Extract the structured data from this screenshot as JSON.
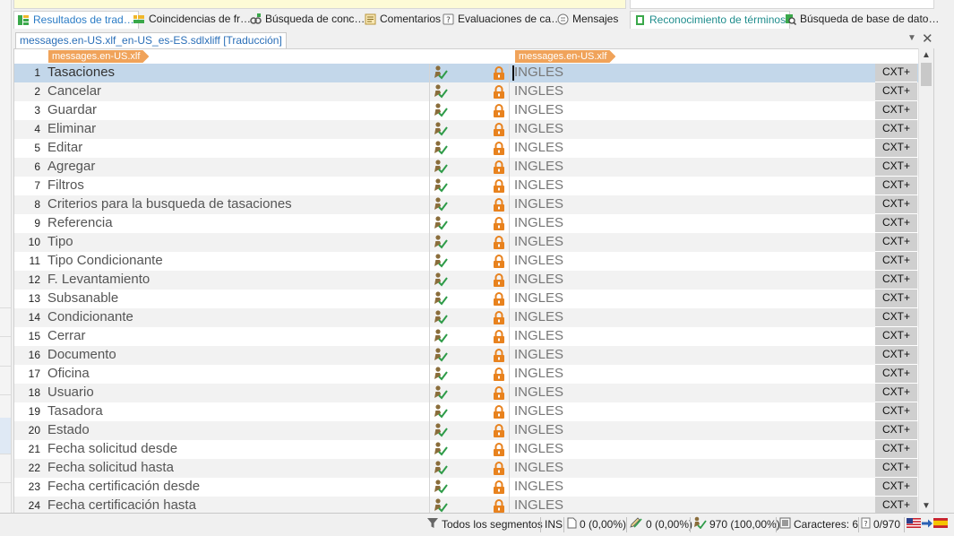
{
  "tabs_left": [
    {
      "label": "Resultados de trad…",
      "icon": "translation-results-icon",
      "active": true
    },
    {
      "label": "Coincidencias de fr…",
      "icon": "fragment-matches-icon"
    },
    {
      "label": "Búsqueda de conc…",
      "icon": "concordance-search-icon"
    },
    {
      "label": "Comentarios",
      "icon": "comments-icon"
    },
    {
      "label": "Evaluaciones de ca…",
      "icon": "quality-evaluation-icon"
    },
    {
      "label": "Mensajes",
      "icon": "messages-icon"
    }
  ],
  "tabs_right": [
    {
      "label": "Reconocimiento de términos",
      "icon": "term-recognition-icon",
      "active": true
    },
    {
      "label": "Búsqueda de base de dato…",
      "icon": "termbase-search-icon"
    }
  ],
  "document": {
    "tab_label": "messages.en-US.xlf_en-US_es-ES.sdlxliff [Traducción]",
    "source_file_tag": "messages.en-US.xlf",
    "target_file_tag": "messages.en-US.xlf"
  },
  "segments": [
    {
      "num": "1",
      "source": "Tasaciones",
      "target": "INGLES",
      "context": "CXT+"
    },
    {
      "num": "2",
      "source": "Cancelar",
      "target": "INGLES",
      "context": "CXT+"
    },
    {
      "num": "3",
      "source": "Guardar",
      "target": "INGLES",
      "context": "CXT+"
    },
    {
      "num": "4",
      "source": "Eliminar",
      "target": "INGLES",
      "context": "CXT+"
    },
    {
      "num": "5",
      "source": "Editar",
      "target": "INGLES",
      "context": "CXT+"
    },
    {
      "num": "6",
      "source": "Agregar",
      "target": "INGLES",
      "context": "CXT+"
    },
    {
      "num": "7",
      "source": "Filtros",
      "target": "INGLES",
      "context": "CXT+"
    },
    {
      "num": "8",
      "source": "Criterios para la busqueda de tasaciones",
      "target": "INGLES",
      "context": "CXT+"
    },
    {
      "num": "9",
      "source": "Referencia",
      "target": "INGLES",
      "context": "CXT+"
    },
    {
      "num": "10",
      "source": "Tipo",
      "target": "INGLES",
      "context": "CXT+"
    },
    {
      "num": "11",
      "source": "Tipo Condicionante",
      "target": "INGLES",
      "context": "CXT+"
    },
    {
      "num": "12",
      "source": "F. Levantamiento",
      "target": "INGLES",
      "context": "CXT+"
    },
    {
      "num": "13",
      "source": "Subsanable",
      "target": "INGLES",
      "context": "CXT+"
    },
    {
      "num": "14",
      "source": "Condicionante",
      "target": "INGLES",
      "context": "CXT+"
    },
    {
      "num": "15",
      "source": "Cerrar",
      "target": "INGLES",
      "context": "CXT+"
    },
    {
      "num": "16",
      "source": "Documento",
      "target": "INGLES",
      "context": "CXT+"
    },
    {
      "num": "17",
      "source": "Oficina",
      "target": "INGLES",
      "context": "CXT+"
    },
    {
      "num": "18",
      "source": "Usuario",
      "target": "INGLES",
      "context": "CXT+"
    },
    {
      "num": "19",
      "source": "Tasadora",
      "target": "INGLES",
      "context": "CXT+"
    },
    {
      "num": "20",
      "source": "Estado",
      "target": "INGLES",
      "context": "CXT+"
    },
    {
      "num": "21",
      "source": "Fecha solicitud desde",
      "target": "INGLES",
      "context": "CXT+"
    },
    {
      "num": "22",
      "source": "Fecha solicitud hasta",
      "target": "INGLES",
      "context": "CXT+"
    },
    {
      "num": "23",
      "source": "Fecha certificación desde",
      "target": "INGLES",
      "context": "CXT+"
    },
    {
      "num": "24",
      "source": "Fecha certificación hasta",
      "target": "INGLES",
      "context": "CXT+"
    }
  ],
  "status_bar": {
    "filter": "Todos los segmentos",
    "mode": "INS",
    "new": "0 (0,00%)",
    "draft": "0 (0,00%)",
    "translated": "970 (100,00%)",
    "characters": "Caracteres: 6",
    "segment_pos": "0/970"
  },
  "colors": {
    "selected_row": "#c3d7ea",
    "file_tag": "#f0a35a",
    "lock": "#e8821e",
    "check": "#2e9b48",
    "context_cell": "#cfcfcf"
  }
}
